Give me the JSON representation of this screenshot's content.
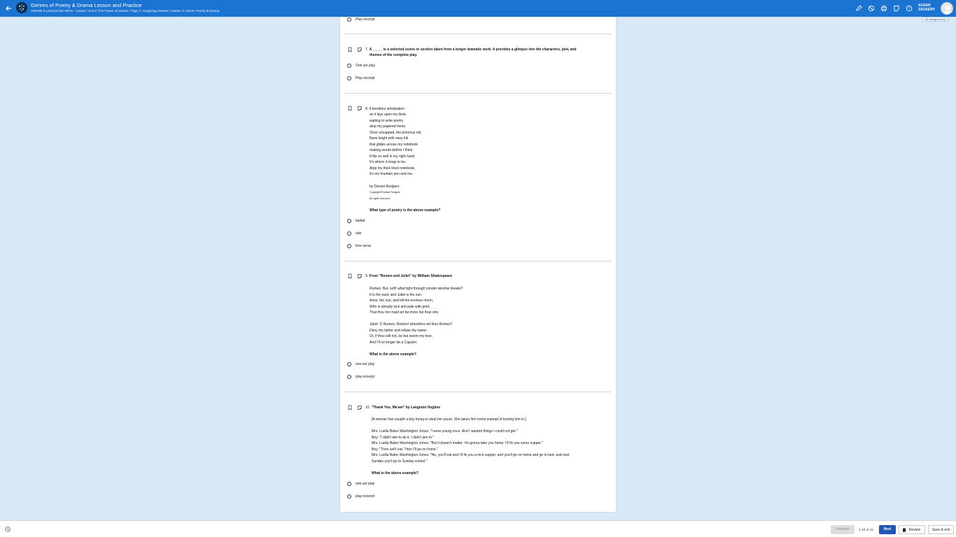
{
  "header": {
    "title": "Genres of Poetry & Drama Lesson and Practice",
    "breadcrumb": "GRADE 6 LANGUAGE ARTS - Comer / Unit 2: The Power of Stories / Topic 7: Analyzing Genres / Lesson 2: Genre: Poetry & Drama",
    "user_name_line1": "AUSAR",
    "user_name_line2": "ZACKERY",
    "changes_saved": "All changes saved",
    "icons": [
      "back-arrow-icon",
      "pencil-icon",
      "block-icon",
      "print-icon",
      "note-icon",
      "help-icon"
    ]
  },
  "questions": [
    {
      "tail_options": [
        "Play excerpt"
      ]
    },
    {
      "number": "7.",
      "prompt_line1": "A _____  is a selected scene or section taken from a longer dramatic work. It provides a glimpse into the characters, plot, and",
      "prompt_line2": "themes of the complete play.",
      "options": [
        "One act play",
        "Play excerpt"
      ]
    },
    {
      "number": "8.",
      "poem_first_line": "It breathes anticipation",
      "poem_lines": "as it lays upon my desk\nwaiting to write poetry\natop my papered mess.\nOnce uncapped, the precious nib\nflows bright with navy ink\nthat glides across my notebook\nmaking words before I think.\nIt fits so well in my right hand.\nIt's where it longs to be.\nAtop my thick lined notebook,\nit's my fountain pen and me.",
      "author": "by Denise Rodgers",
      "copyright": "Copyright©Denise Rodgers",
      "rights": "All rights reserved.",
      "question": "What type of poetry is the above example?",
      "options": [
        "ballad",
        "ode",
        "free verse"
      ]
    },
    {
      "number": "9.",
      "title": "From \"Romeo and Juliet\" by William Shakespeare",
      "passage": "Romeo: But, soft! what light through yonder window breaks?\nIt is the east, and Juliet is the sun.\nArise, fair sun, and kill the envious moon,\nWho is already sick and pale with grief,\nThat thou her maid art far more fair than she.\n\nJuliet: O Romeo, Romeo! wherefore art thou Romeo?\nDeny thy father and refuse thy name;\nOr, if thou wilt not, be but sworn my love,\nAnd I'll no longer be a Capulet.",
      "question": "What is the above example?",
      "options": [
        "one-act play",
        "play excerpt"
      ]
    },
    {
      "number": "10.",
      "title": "\"Thank You, Ma'am\" by Langston Hughes",
      "stage_direction": "[A woman has caught a boy trying to steal her purse. She takes him home instead of turning him in.]",
      "passage": "Mrs. Luella Bates Washington Jones: \"I were young once. And I wanted things I could not get.\"\nBoy: \"I didn't aim to do it. I didn't aim to.\"\nMrs. Luella Bates Washington Jones: \"But it doesn't matter. I'm gonna take you home. I'll fix you some supper.\"\nBoy: \"Then we'll eat. Then I'll go on home.\"\nMrs. Luella Bates Washington Jones: \"No, you'll eat and I'll fix you a nice supper, and you'll go on home and go to bed, and next\nSunday you'll go to Sunday school.\"",
      "question": "What is the above example?",
      "options": [
        "one-act play",
        "play excerpt"
      ]
    }
  ],
  "footer": {
    "previous_label": "Previous",
    "page_count": "1-10 of 10",
    "next_label": "Next",
    "review_label": "Review",
    "save_exit_label": "Save & exit"
  },
  "colors": {
    "topbar": "#1b74d1",
    "background": "#d8e8f7",
    "next_button": "#2454b4"
  }
}
